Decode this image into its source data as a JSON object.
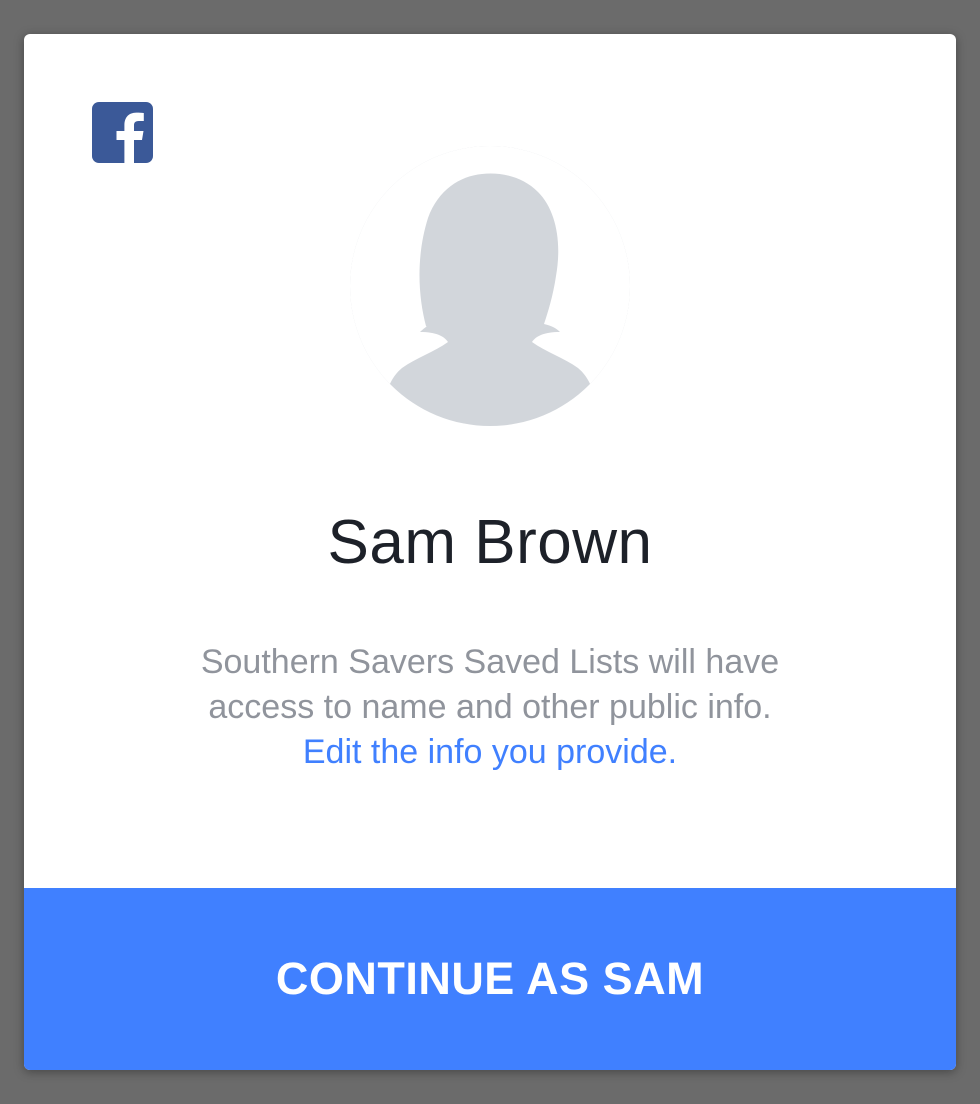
{
  "colors": {
    "overlay": "#6b6b6b",
    "dialog_bg": "#ffffff",
    "facebook_blue": "#3b5998",
    "accent": "#4080ff",
    "name_text": "#1d2129",
    "secondary_text": "#90949c",
    "avatar_placeholder": "#d2d6db"
  },
  "header": {
    "logo_icon": "facebook-icon"
  },
  "profile": {
    "avatar_icon": "default-female-avatar-icon",
    "name": "Sam Brown"
  },
  "permissions": {
    "line1": "Southern Savers Saved Lists will have",
    "line2": "access to name and other public info.",
    "edit_link": "Edit the info you provide."
  },
  "actions": {
    "continue_label": "CONTINUE AS SAM"
  }
}
